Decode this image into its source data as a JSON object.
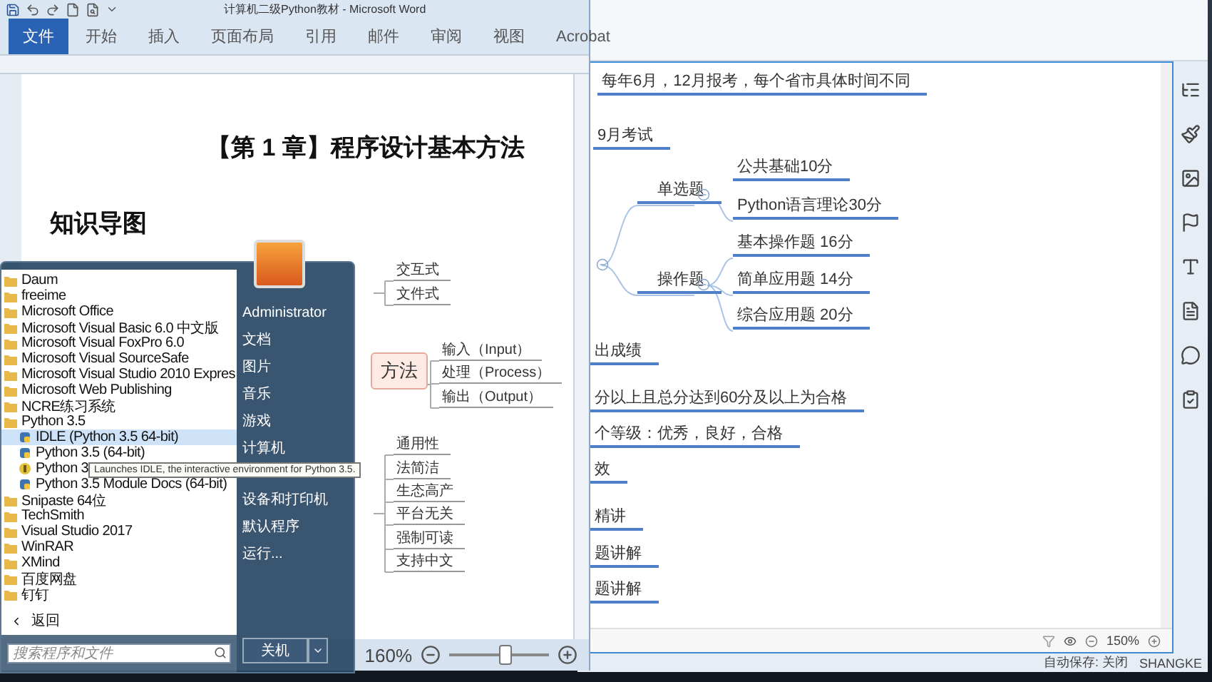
{
  "word": {
    "title": "计算机二级Python教材 - Microsoft Word",
    "tabs": [
      {
        "label": "文件",
        "selected": true
      },
      {
        "label": "开始",
        "selected": false
      },
      {
        "label": "插入",
        "selected": false
      },
      {
        "label": "页面布局",
        "selected": false
      },
      {
        "label": "引用",
        "selected": false
      },
      {
        "label": "邮件",
        "selected": false
      },
      {
        "label": "审阅",
        "selected": false
      },
      {
        "label": "视图",
        "selected": false
      },
      {
        "label": "Acrobat",
        "selected": false
      }
    ],
    "heading": "【第 1 章】程序设计基本方法",
    "subheading": "知识导图",
    "mindmap": {
      "center": "方法",
      "groups": [
        [
          "交互式",
          "文件式"
        ],
        [
          "输入（Input）",
          "处理（Process）",
          "输出（Output）"
        ],
        [
          "通用性",
          "法简洁",
          "生态高产",
          "平台无关",
          "强制可读",
          "支持中文"
        ]
      ]
    },
    "zoom": "160%",
    "zoom_slider": {
      "level": 0.55
    }
  },
  "xmind": {
    "notes_top": [
      "每年6月，12月报考，每个省市具体时间不同",
      "9月考试"
    ],
    "exam_types": [
      {
        "label": "单选题",
        "children": [
          "公共基础10分",
          "Python语言理论30分"
        ]
      },
      {
        "label": "操作题",
        "children": [
          "基本操作题 16分",
          "简单应用题 14分",
          "综合应用题 20分"
        ]
      }
    ],
    "notes_bottom": [
      "出成绩",
      "分以上且总分达到60分及以上为合格",
      "个等级：优秀，良好，合格",
      "效",
      "精讲",
      "题讲解",
      "题讲解"
    ],
    "zoom": "150%",
    "autosave": "自动保存: 关闭",
    "user": "SHANGKE"
  },
  "start_menu": {
    "programs": [
      {
        "label": "Daum",
        "kind": "folder",
        "selected": false
      },
      {
        "label": "freeime",
        "kind": "folder",
        "selected": false
      },
      {
        "label": "Microsoft Office",
        "kind": "folder",
        "selected": false
      },
      {
        "label": "Microsoft Visual Basic 6.0 中文版",
        "kind": "folder",
        "selected": false
      },
      {
        "label": "Microsoft Visual FoxPro 6.0",
        "kind": "folder",
        "selected": false
      },
      {
        "label": "Microsoft Visual SourceSafe",
        "kind": "folder",
        "selected": false
      },
      {
        "label": "Microsoft Visual Studio 2010 Expres",
        "kind": "folder",
        "selected": false
      },
      {
        "label": "Microsoft Web Publishing",
        "kind": "folder",
        "selected": false
      },
      {
        "label": "NCRE练习系统",
        "kind": "folder",
        "selected": false
      },
      {
        "label": "Python 3.5",
        "kind": "folder",
        "selected": false,
        "children": [
          {
            "label": "IDLE (Python 3.5 64-bit)",
            "kind": "app",
            "selected": true
          },
          {
            "label": "Python 3.5 (64-bit)",
            "kind": "app",
            "selected": false
          },
          {
            "label": "Python 3",
            "kind": "help",
            "selected": false
          },
          {
            "label": "Python 3.5 Module Docs (64-bit)",
            "kind": "app",
            "selected": false
          }
        ]
      },
      {
        "label": "Snipaste 64位",
        "kind": "folder",
        "selected": false
      },
      {
        "label": "TechSmith",
        "kind": "folder",
        "selected": false
      },
      {
        "label": "Visual Studio 2017",
        "kind": "folder",
        "selected": false
      },
      {
        "label": "WinRAR",
        "kind": "folder",
        "selected": false
      },
      {
        "label": "XMind",
        "kind": "folder",
        "selected": false
      },
      {
        "label": "百度网盘",
        "kind": "folder",
        "selected": false
      },
      {
        "label": "钉钉",
        "kind": "folder",
        "selected": false
      }
    ],
    "back": "返回",
    "search": {
      "placeholder": "搜索程序和文件"
    },
    "user": "Administrator",
    "places": [
      "文档",
      "图片",
      "音乐",
      "游戏",
      "计算机"
    ],
    "settings": [
      "设备和打印机",
      "默认程序",
      "运行..."
    ],
    "shutdown": "关机"
  },
  "tooltip": "Launches IDLE, the interactive environment for Python 3.5."
}
